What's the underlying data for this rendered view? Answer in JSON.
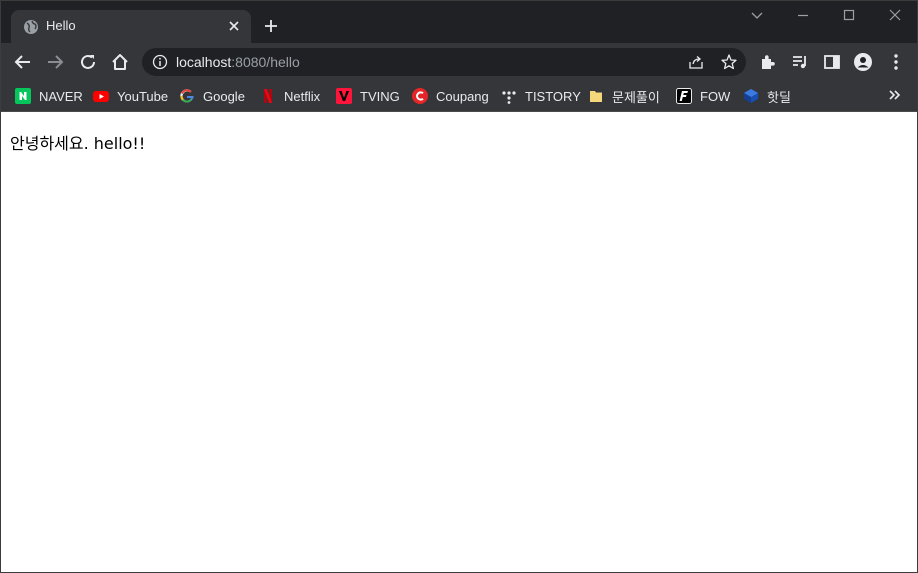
{
  "tab": {
    "title": "Hello"
  },
  "omnibox": {
    "host": "localhost",
    "rest": ":8080/hello"
  },
  "bookmarks": [
    {
      "label": "NAVER",
      "icon": "naver-icon"
    },
    {
      "label": "YouTube",
      "icon": "youtube-icon"
    },
    {
      "label": "Google",
      "icon": "google-icon"
    },
    {
      "label": "Netflix",
      "icon": "netflix-icon"
    },
    {
      "label": "TVING",
      "icon": "tving-icon"
    },
    {
      "label": "Coupang",
      "icon": "coupang-icon"
    },
    {
      "label": "TISTORY",
      "icon": "tistory-icon"
    },
    {
      "label": "문제풀이",
      "icon": "folder-icon"
    },
    {
      "label": "FOW",
      "icon": "fow-icon"
    },
    {
      "label": "핫딜",
      "icon": "hotdeal-icon"
    }
  ],
  "page": {
    "text": "안녕하세요. hello!!"
  },
  "colors": {
    "frame": "#202124",
    "toolbar": "#35363a",
    "text_light": "#e8eaed",
    "text_dim": "#9aa0a6",
    "page_bg": "#ffffff"
  }
}
